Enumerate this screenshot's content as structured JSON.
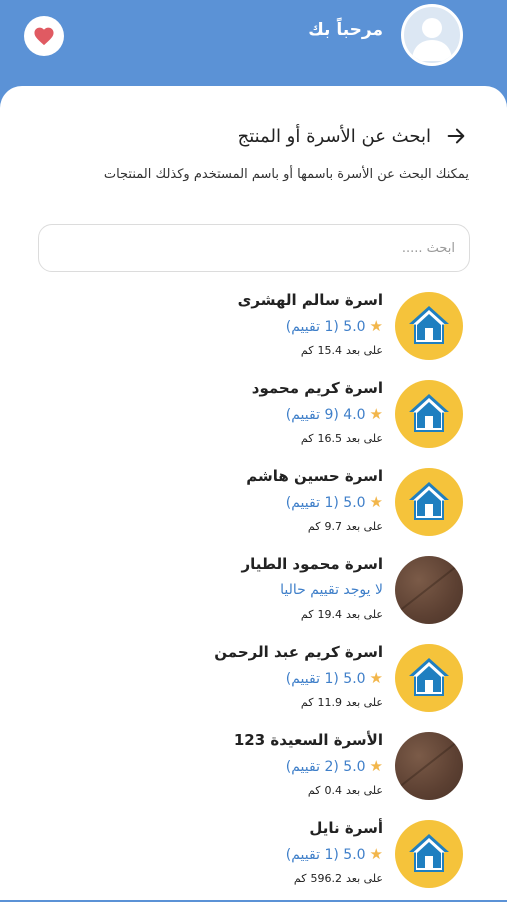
{
  "header": {
    "greeting": "مرحباً بك",
    "favorites_icon": "heart-icon",
    "avatar_icon": "user-avatar-icon"
  },
  "page": {
    "title": "ابحث عن الأسرة أو المنتج",
    "back_icon": "arrow-right-icon",
    "hint": "يمكنك البحث عن الأسرة باسمها أو باسم المستخدم وكذلك المنتجات"
  },
  "search": {
    "placeholder": "ابحث .....",
    "value": ""
  },
  "colors": {
    "header": "#5b92d6",
    "accent_link": "#3f7fc9",
    "star": "#f2b64b",
    "house_logo_bg": "#f5c33b",
    "heart": "#e05a62"
  },
  "distance_prefix": "على بعد",
  "distance_unit": "كم",
  "families": [
    {
      "name": "اسرة سالم الهشرى",
      "rating": "5.0",
      "count": "(1 تقييم)",
      "distance": "15.4",
      "logo": "house"
    },
    {
      "name": "اسرة كريم محمود",
      "rating": "4.0",
      "count": "(9 تقييم)",
      "distance": "16.5",
      "logo": "house"
    },
    {
      "name": "اسرة حسين هاشم",
      "rating": "5.0",
      "count": "(1 تقييم)",
      "distance": "9.7",
      "logo": "house"
    },
    {
      "name": "اسرة محمود الطيار",
      "no_rating": "لا يوجد تقييم حاليا",
      "distance": "19.4",
      "logo": "wood"
    },
    {
      "name": "اسرة كريم عبد الرحمن",
      "rating": "5.0",
      "count": "(1 تقييم)",
      "distance": "11.9",
      "logo": "house"
    },
    {
      "name": "الأسرة السعيدة 123",
      "rating": "5.0",
      "count": "(2 تقييم)",
      "distance": "0.4",
      "logo": "wood"
    },
    {
      "name": "أسرة نايل",
      "rating": "5.0",
      "count": "(1 تقييم)",
      "distance": "596.2",
      "logo": "house"
    }
  ]
}
